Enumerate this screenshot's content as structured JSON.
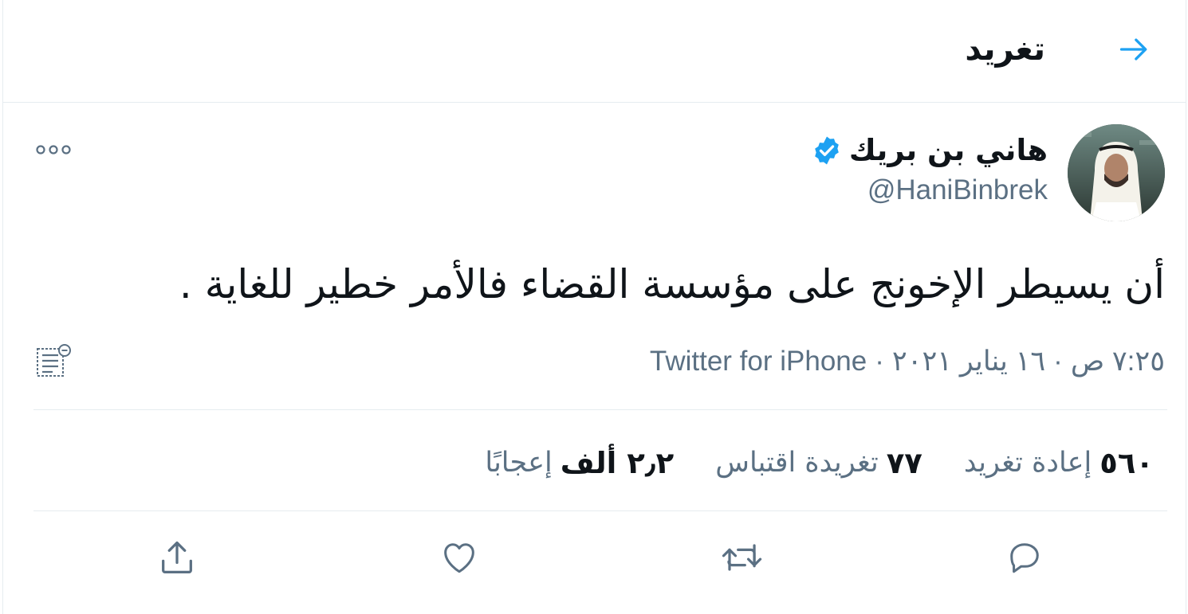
{
  "header": {
    "title": "تغريد",
    "back_icon": "arrow-right-icon"
  },
  "author": {
    "display_name": "هاني بن بريك",
    "handle": "@HaniBinbrek",
    "verified": true
  },
  "tweet": {
    "text": "أن يسيطر الإخونج على مؤسسة القضاء فالأمر خطير للغاية ."
  },
  "meta": {
    "time": "٧:٢٥ ص",
    "date": "١٦ يناير ٢٠٢١",
    "separator": "·",
    "source": "Twitter for iPhone"
  },
  "stats": {
    "retweets_count": "٥٦٠",
    "retweets_label": "إعادة تغريد",
    "quotes_count": "٧٧",
    "quotes_label": "تغريدة اقتباس",
    "likes_count": "٢٫٢ ألف",
    "likes_label": "إعجابًا"
  },
  "actions": [
    "reply-icon",
    "retweet-icon",
    "like-icon",
    "share-icon"
  ],
  "colors": {
    "accent": "#1da1f2",
    "secondary_text": "#5b7083",
    "divider": "#e6ecf0",
    "primary_text": "#0f1419"
  }
}
